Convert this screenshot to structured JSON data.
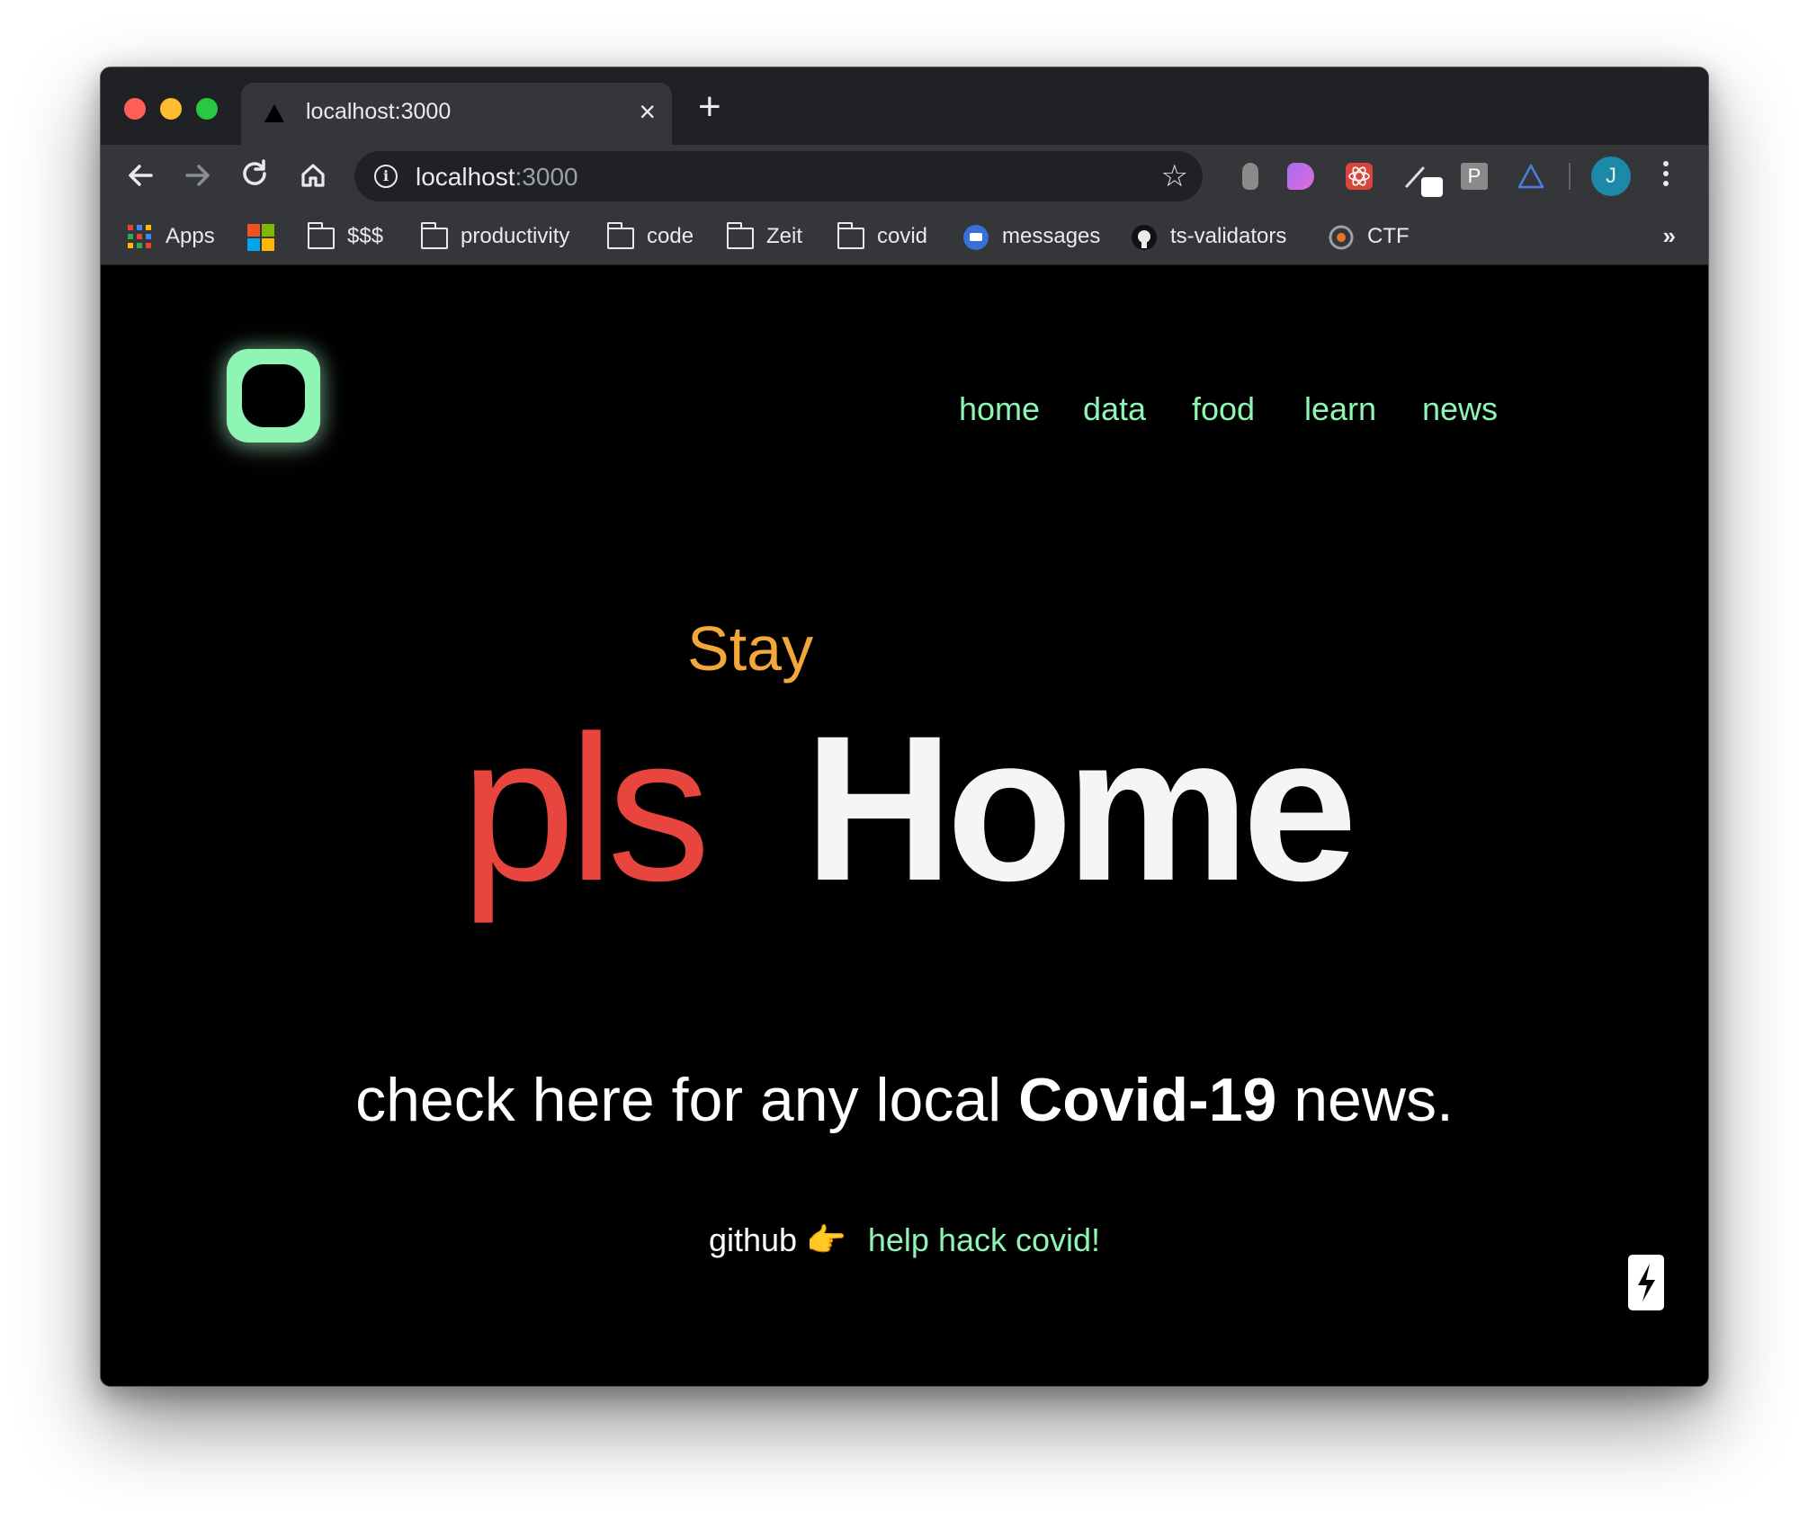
{
  "browser": {
    "tab_title": "localhost:3000",
    "tab_close": "×",
    "new_tab": "+",
    "url_host": "localhost",
    "url_port": ":3000",
    "info_icon": "i",
    "star": "☆",
    "avatar_initial": "J",
    "bookmarks": [
      {
        "label": "Apps",
        "icon": "apps-grid-icon"
      },
      {
        "label": "",
        "icon": "microsoft-icon"
      },
      {
        "label": "$$$",
        "icon": "folder-icon"
      },
      {
        "label": "productivity",
        "icon": "folder-icon"
      },
      {
        "label": "code",
        "icon": "folder-icon"
      },
      {
        "label": "Zeit",
        "icon": "folder-icon"
      },
      {
        "label": "covid",
        "icon": "folder-icon"
      },
      {
        "label": "messages",
        "icon": "messages-icon"
      },
      {
        "label": "ts-validators",
        "icon": "github-icon"
      },
      {
        "label": "CTF",
        "icon": "ctf-icon"
      }
    ],
    "bookmarks_more": "»"
  },
  "site": {
    "nav": [
      "home",
      "data",
      "food",
      "learn",
      "news"
    ],
    "hero": {
      "stay": "Stay",
      "pls": "pls",
      "home": "Home"
    },
    "tagline": {
      "before": "check here for any local ",
      "bold": "Covid-19",
      "after": " news."
    },
    "github": {
      "label": "github",
      "emoji": "👉",
      "link": "help hack covid!"
    }
  },
  "colors": {
    "accent_green": "#8ef5b4",
    "stay_orange": "#f1a73a",
    "pls_red": "#e8453f"
  }
}
